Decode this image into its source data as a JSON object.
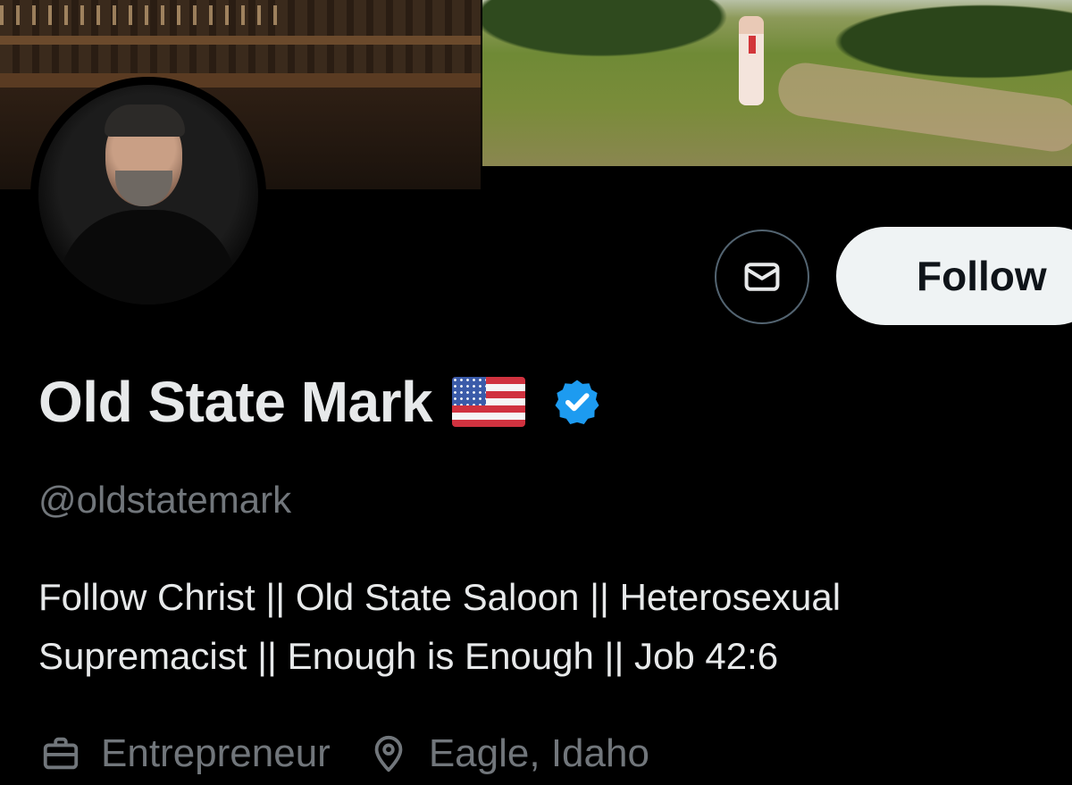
{
  "profile": {
    "display_name": "Old State Mark",
    "name_emoji": "us-flag",
    "verified_badge": "blue-check",
    "handle": "@oldstatemark",
    "bio": "Follow Christ || Old State Saloon || Heterosexual Supremacist || Enough is Enough || Job 42:6",
    "profession": "Entrepreneur",
    "location": "Eagle, Idaho"
  },
  "actions": {
    "message_icon": "envelope-icon",
    "follow_label": "Follow"
  },
  "colors": {
    "background": "#000000",
    "primary_text": "#e7e9ea",
    "secondary_text": "#71767b",
    "verified_blue": "#1d9bf0",
    "follow_button_bg": "#eff3f4",
    "follow_button_text": "#0f1419",
    "border": "#536471"
  }
}
